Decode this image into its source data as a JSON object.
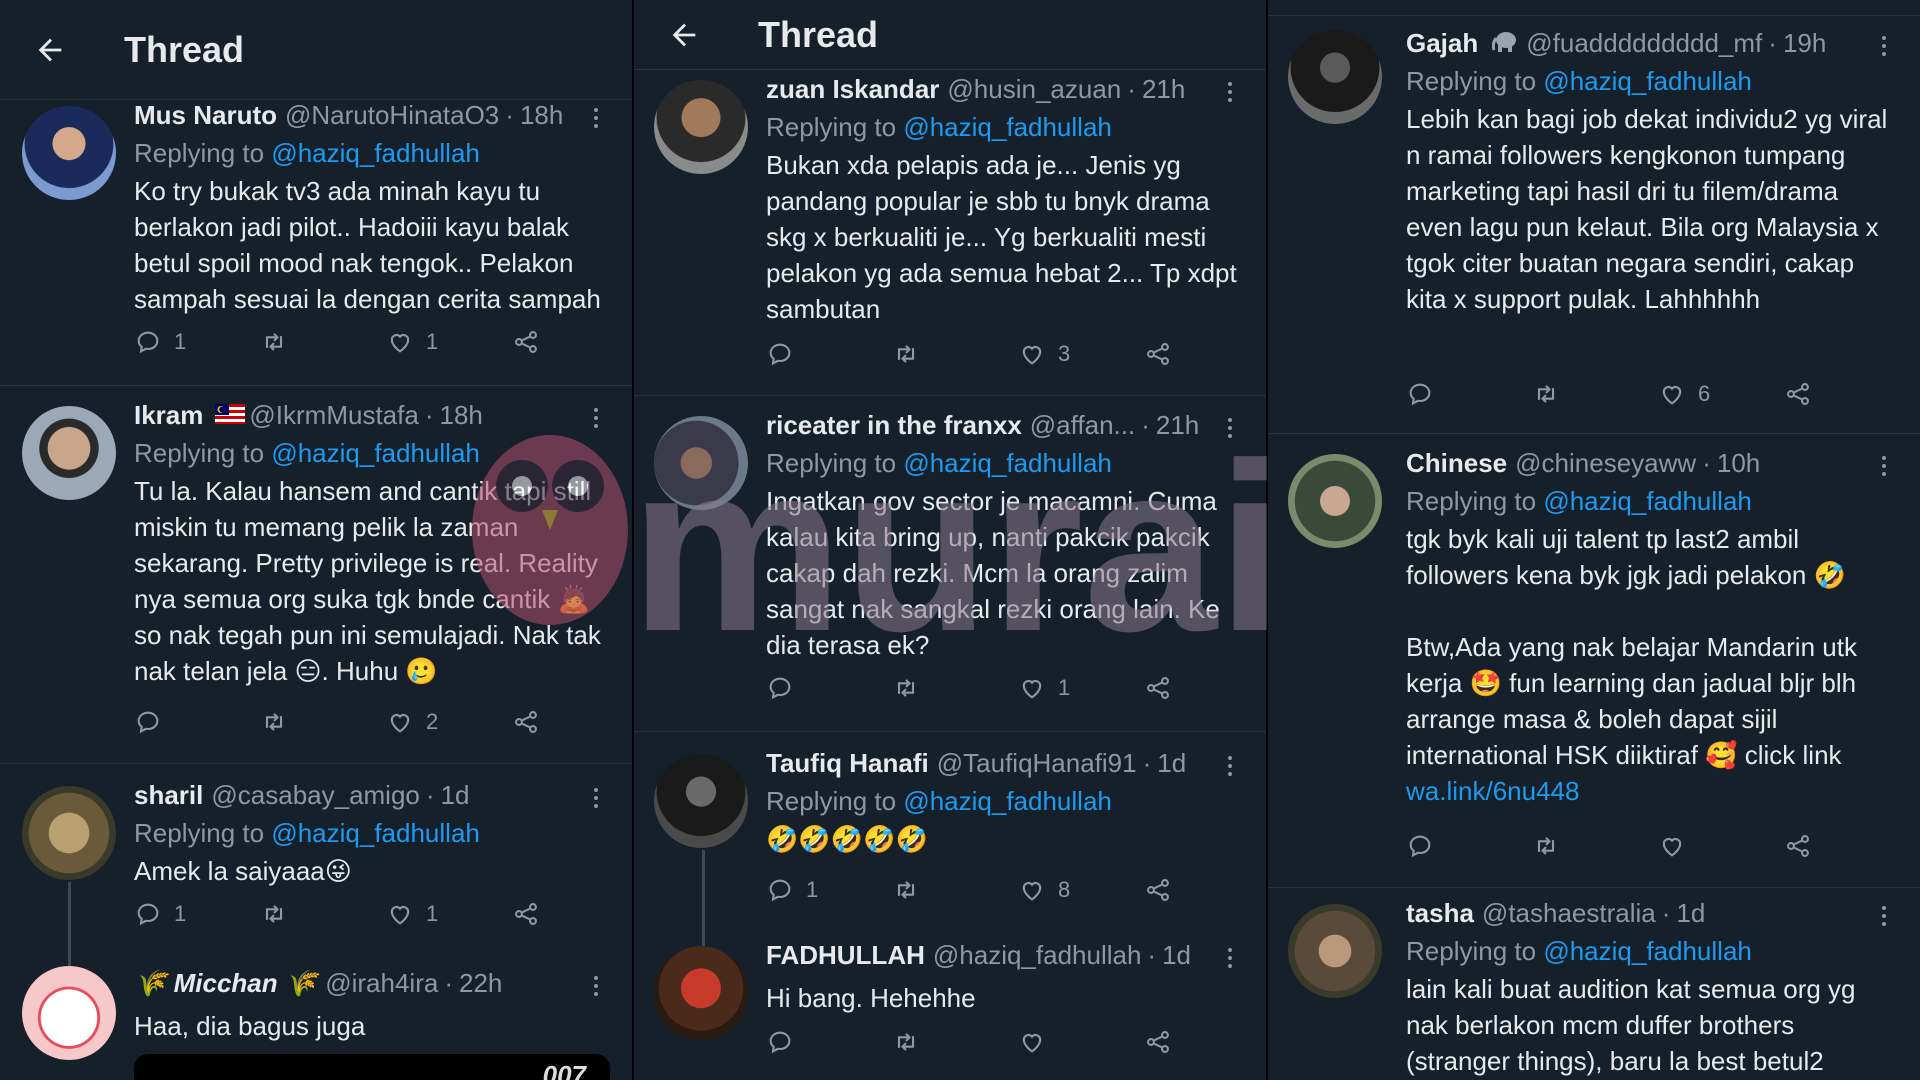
{
  "columns": [
    {
      "header": {
        "title": "Thread"
      },
      "tweets": [
        {
          "name": "Mus Naruto",
          "handle": "@NarutoHinataO3",
          "time": "18h",
          "replying_label": "Replying to",
          "replying_to": "@haziq_fadhullah",
          "text": "Ko try bukak tv3 ada minah kayu tu berlakon jadi pilot.. Hadoiii kayu balak betul spoil mood nak tengok.. Pelakon sampah sesuai la dengan cerita sampah",
          "reply_count": "1",
          "retweet_count": "",
          "like_count": "1",
          "avatar_color": "#3a5a9a"
        },
        {
          "name": "Ikram",
          "handle": "@IkrmMustafa",
          "time": "18h",
          "replying_label": "Replying to",
          "replying_to": "@haziq_fadhullah",
          "text": "Tu la. Kalau hansem and cantik tapi still miskin tu memang pelik la zaman sekarang. Pretty privilege is real. Reality nya semua org suka tgk bnde cantik 🙇 so nak tegah pun ini semulajadi. Nak tak nak telan jela 😑. Huhu 🥲",
          "reply_count": "",
          "retweet_count": "",
          "like_count": "2",
          "avatar_color": "#6b7a8a"
        },
        {
          "name": "sharil",
          "handle": "@casabay_amigo",
          "time": "1d",
          "replying_label": "Replying to",
          "replying_to": "@haziq_fadhullah",
          "text": "Amek la saiyaaa😜",
          "reply_count": "1",
          "retweet_count": "",
          "like_count": "1",
          "avatar_color": "#8a7a5a"
        },
        {
          "name": "🌾 Micchan 🌾",
          "handle": "@irah4ira",
          "time": "22h",
          "text": "Haa, dia bagus juga",
          "media_label": "007",
          "avatar_color": "#f2d0d0"
        }
      ]
    },
    {
      "header": {
        "title": "Thread"
      },
      "tweets": [
        {
          "name": "zuan Iskandar",
          "handle": "@husin_azuan",
          "time": "21h",
          "replying_label": "Replying to",
          "replying_to": "@haziq_fadhullah",
          "text": "Bukan xda pelapis ada je... Jenis yg pandang popular je sbb tu bnyk drama skg x berkualiti je... Yg berkualiti mesti pelakon yg ada semua hebat 2... Tp xdpt sambutan",
          "reply_count": "",
          "retweet_count": "",
          "like_count": "3",
          "avatar_color": "#555"
        },
        {
          "name": "riceater in the franxx",
          "handle": "@affan...",
          "time": "21h",
          "replying_label": "Replying to",
          "replying_to": "@haziq_fadhullah",
          "text": "Ingatkan gov sector je macamni. Cuma kalau kita bring up, nanti pakcik pakcik cakap dah rezki. Mcm la orang zalim sangat nak sangkal rezki orang lain. Ke dia terasa ek?",
          "reply_count": "",
          "retweet_count": "",
          "like_count": "1",
          "avatar_color": "#4a4a5a"
        },
        {
          "name": "Taufiq Hanafi",
          "handle": "@TaufiqHanafi91",
          "time": "1d",
          "replying_label": "Replying to",
          "replying_to": "@haziq_fadhullah",
          "text": "🤣🤣🤣🤣🤣",
          "reply_count": "1",
          "retweet_count": "",
          "like_count": "8",
          "avatar_color": "#333"
        },
        {
          "name": "FADHULLAH",
          "handle": "@haziq_fadhullah",
          "time": "1d",
          "text": "Hi bang. Hehehhe",
          "reply_count": "",
          "retweet_count": "",
          "like_count": "",
          "avatar_color": "#6a3a2a"
        }
      ]
    },
    {
      "tweets": [
        {
          "name": "Gajah",
          "handle": "@fuaddddddddd_mf",
          "time": "19h",
          "replying_label": "Replying to",
          "replying_to": "@haziq_fadhullah",
          "text": "Lebih kan bagi job dekat individu2 yg viral n ramai followers kengkonon tumpang marketing tapi hasil dri tu filem/drama even lagu pun kelaut. Bila org Malaysia x tgok citer buatan negara sendiri, cakap kita x support pulak. Lahhhhhh",
          "reply_count": "",
          "retweet_count": "",
          "like_count": "6",
          "avatar_color": "#333"
        },
        {
          "name": "Chinese",
          "handle": "@chineseyaww",
          "time": "10h",
          "replying_label": "Replying to",
          "replying_to": "@haziq_fadhullah",
          "text": "tgk byk kali uji talent tp last2 ambil followers kena byk jgk jadi pelakon 🤣\n\nBtw,Ada yang nak belajar Mandarin utk kerja 🤩 fun learning dan jadual bljr blh arrange masa & boleh dapat sijil international HSK diiktiraf 🥰 click link ",
          "link": "wa.link/6nu448",
          "reply_count": "",
          "retweet_count": "",
          "like_count": "",
          "avatar_color": "#5a6a4a"
        },
        {
          "name": "tasha",
          "handle": "@tashaestralia",
          "time": "1d",
          "replying_label": "Replying to",
          "replying_to": "@haziq_fadhullah",
          "text": "lain kali buat audition kat semua org yg nak berlakon mcm duffer brothers (stranger things), baru la best betul2",
          "avatar_color": "#6a5a4a"
        }
      ]
    }
  ],
  "watermark": "murai",
  "colors": {
    "background": "#15202b",
    "link": "#1d9bf0",
    "muted": "#8b98a5",
    "text": "#e7e9ea"
  }
}
